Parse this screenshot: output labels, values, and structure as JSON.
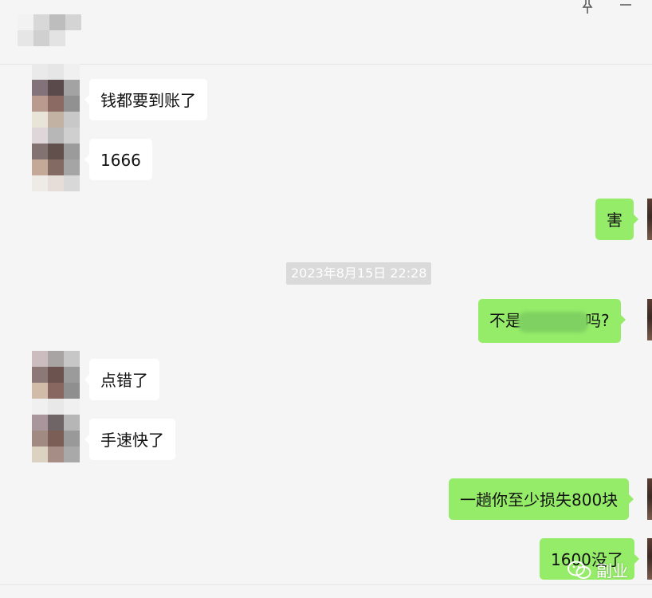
{
  "header": {
    "title_pixelated": true
  },
  "messages": [
    {
      "side": "left",
      "text": "钱都要到账了"
    },
    {
      "side": "left",
      "text": "1666"
    },
    {
      "side": "right",
      "text": "害"
    },
    {
      "side": "right",
      "text_prefix": "不是",
      "text_suffix": "吗?",
      "redacted": true
    },
    {
      "side": "left",
      "text": "点错了"
    },
    {
      "side": "left",
      "text": "手速快了"
    },
    {
      "side": "right",
      "text": "一趟你至少损失800块"
    },
    {
      "side": "right",
      "text": "1600没了"
    }
  ],
  "timestamp": "2023年8月15日 22:28",
  "watermark": {
    "text": "副业",
    "icon": "wechat-icon"
  },
  "colors": {
    "bubble_self": "#95ec69",
    "bubble_other": "#ffffff",
    "background": "#f5f5f5"
  }
}
